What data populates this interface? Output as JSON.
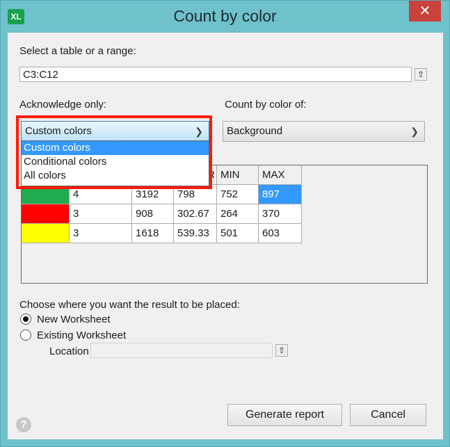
{
  "window": {
    "title": "Count by color",
    "app_icon_text": "XL",
    "close_glyph": "✕"
  },
  "range_section": {
    "label": "Select a table or a range:",
    "value": "C3:C12",
    "select_button_icon": "arrow-up-icon"
  },
  "acknowledge": {
    "label": "Acknowledge only:",
    "selected": "Custom colors",
    "options": [
      "Custom colors",
      "Conditional colors",
      "All colors"
    ]
  },
  "count_of": {
    "label": "Count by color of:",
    "selected": "Background"
  },
  "table": {
    "headers": [
      "",
      "",
      "",
      "R",
      "MIN",
      "MAX"
    ],
    "rows": [
      {
        "color": "#1fab4e",
        "values": [
          "4",
          "3192",
          "798",
          "752",
          "897"
        ]
      },
      {
        "color": "#ff0000",
        "values": [
          "3",
          "908",
          "302.67",
          "264",
          "370"
        ]
      },
      {
        "color": "#ffff00",
        "values": [
          "3",
          "1618",
          "539.33",
          "501",
          "603"
        ]
      }
    ]
  },
  "placement": {
    "label": "Choose where you want the result to be placed:",
    "new_worksheet": "New Worksheet",
    "existing_worksheet": "Existing Worksheet",
    "location_label": "Location",
    "location_value": ""
  },
  "buttons": {
    "generate": "Generate report",
    "cancel": "Cancel",
    "help": "?"
  },
  "colors": {
    "title_bar": "#6fc1cc",
    "close": "#c9423b",
    "selection": "#3399ff",
    "highlight": "#ff1a0a"
  }
}
